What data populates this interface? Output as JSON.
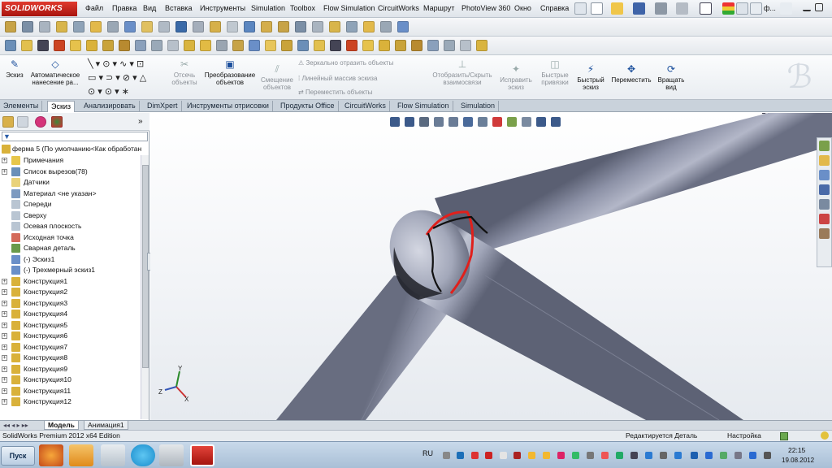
{
  "app": {
    "logo": "SOLIDWORKS"
  },
  "menu": [
    "Файл",
    "Правка",
    "Вид",
    "Вставка",
    "Инструменты",
    "Simulation",
    "Toolbox",
    "Flow Simulation",
    "CircuitWorks",
    "Маршрут",
    "PhotoView 360",
    "Окно",
    "Справка"
  ],
  "search_text": "ф...",
  "command_manager": {
    "sketch": "Эскиз",
    "smart_dim": [
      "Автоматическое",
      "нанесение ра..."
    ],
    "trim": [
      "Отсечь",
      "объекты"
    ],
    "convert": [
      "Преобразование",
      "объектов"
    ],
    "offset": [
      "Смещение",
      "объектов"
    ],
    "mirror": "Зеркально отразить объекты",
    "linear_pattern": "Линейный массив эскиза",
    "move_entities": "Переместить объекты",
    "show_hide": [
      "Отобразить/Скрыть",
      "взаимосвязи"
    ],
    "repair": [
      "Исправить",
      "эскиз"
    ],
    "quick_snaps": [
      "Быстрые",
      "привязки"
    ],
    "rapid_sketch": [
      "Быстрый",
      "эскиз"
    ],
    "move": "Переместить",
    "rotate": [
      "Вращать",
      "вид"
    ]
  },
  "tabs": [
    "Элементы",
    "Эскиз",
    "Анализировать",
    "DimXpert",
    "Инструменты отрисовки",
    "Продукты Office",
    "CircuitWorks",
    "Flow Simulation",
    "Simulation"
  ],
  "active_tab": "Эскиз",
  "feature_tree": {
    "root": "ферма 5  (По умолчанию<Как обработан",
    "items": [
      {
        "label": "Примечания",
        "exp": true,
        "icon": "annotations-icon",
        "color": "#e7c64a"
      },
      {
        "label": "Список вырезов(78)",
        "exp": true,
        "icon": "cutlist-icon",
        "color": "#6a8fb8"
      },
      {
        "label": "Датчики",
        "exp": false,
        "icon": "sensor-icon",
        "color": "#e9d27a"
      },
      {
        "label": "Материал <не указан>",
        "exp": false,
        "icon": "material-icon",
        "color": "#7d9ac0"
      },
      {
        "label": "Спереди",
        "exp": false,
        "icon": "plane-icon",
        "color": "#b9c5d2"
      },
      {
        "label": "Сверху",
        "exp": false,
        "icon": "plane-icon",
        "color": "#b9c5d2"
      },
      {
        "label": "Осевая плоскость",
        "exp": false,
        "icon": "plane-icon",
        "color": "#b9c5d2"
      },
      {
        "label": "Исходная точка",
        "exp": false,
        "icon": "origin-icon",
        "color": "#d46a5a"
      },
      {
        "label": "Сварная деталь",
        "exp": false,
        "icon": "weldment-icon",
        "color": "#6a9a4a"
      },
      {
        "label": "(-) Эскиз1",
        "exp": false,
        "icon": "sketch-icon",
        "color": "#6a8fc8"
      },
      {
        "label": "(-) Трехмерный эскиз1",
        "exp": false,
        "icon": "sketch3d-icon",
        "color": "#6a8fc8"
      },
      {
        "label": "Конструкция1",
        "exp": true,
        "icon": "structure-icon",
        "color": "#d9b13a"
      },
      {
        "label": "Конструкция2",
        "exp": true,
        "icon": "structure-icon",
        "color": "#d9b13a"
      },
      {
        "label": "Конструкция3",
        "exp": true,
        "icon": "structure-icon",
        "color": "#d9b13a"
      },
      {
        "label": "Конструкция4",
        "exp": true,
        "icon": "structure-icon",
        "color": "#d9b13a"
      },
      {
        "label": "Конструкция5",
        "exp": true,
        "icon": "structure-icon",
        "color": "#d9b13a"
      },
      {
        "label": "Конструкция6",
        "exp": true,
        "icon": "structure-icon",
        "color": "#d9b13a"
      },
      {
        "label": "Конструкция7",
        "exp": true,
        "icon": "structure-icon",
        "color": "#d9b13a"
      },
      {
        "label": "Конструкция8",
        "exp": true,
        "icon": "structure-icon",
        "color": "#d9b13a"
      },
      {
        "label": "Конструкция9",
        "exp": true,
        "icon": "structure-icon",
        "color": "#d9b13a"
      },
      {
        "label": "Конструкция10",
        "exp": true,
        "icon": "structure-icon",
        "color": "#d9b13a"
      },
      {
        "label": "Конструкция11",
        "exp": true,
        "icon": "structure-icon",
        "color": "#d9b13a"
      },
      {
        "label": "Конструкция12",
        "exp": true,
        "icon": "structure-icon",
        "color": "#d9b13a"
      }
    ]
  },
  "bottom_tabs": [
    "Модель",
    "Анимация1"
  ],
  "status": {
    "edition": "SolidWorks Premium 2012 x64 Edition",
    "editing": "Редактируется Деталь",
    "custom": "Настройка"
  },
  "taskbar": {
    "start": "Пуск",
    "lang": "RU",
    "time": "22:15",
    "date": "19.08.2012"
  },
  "colors": {
    "tube": "#9aa0b4",
    "sketch_red": "#e0201c",
    "sketch_black": "#111111",
    "accent": "#c0201a"
  }
}
